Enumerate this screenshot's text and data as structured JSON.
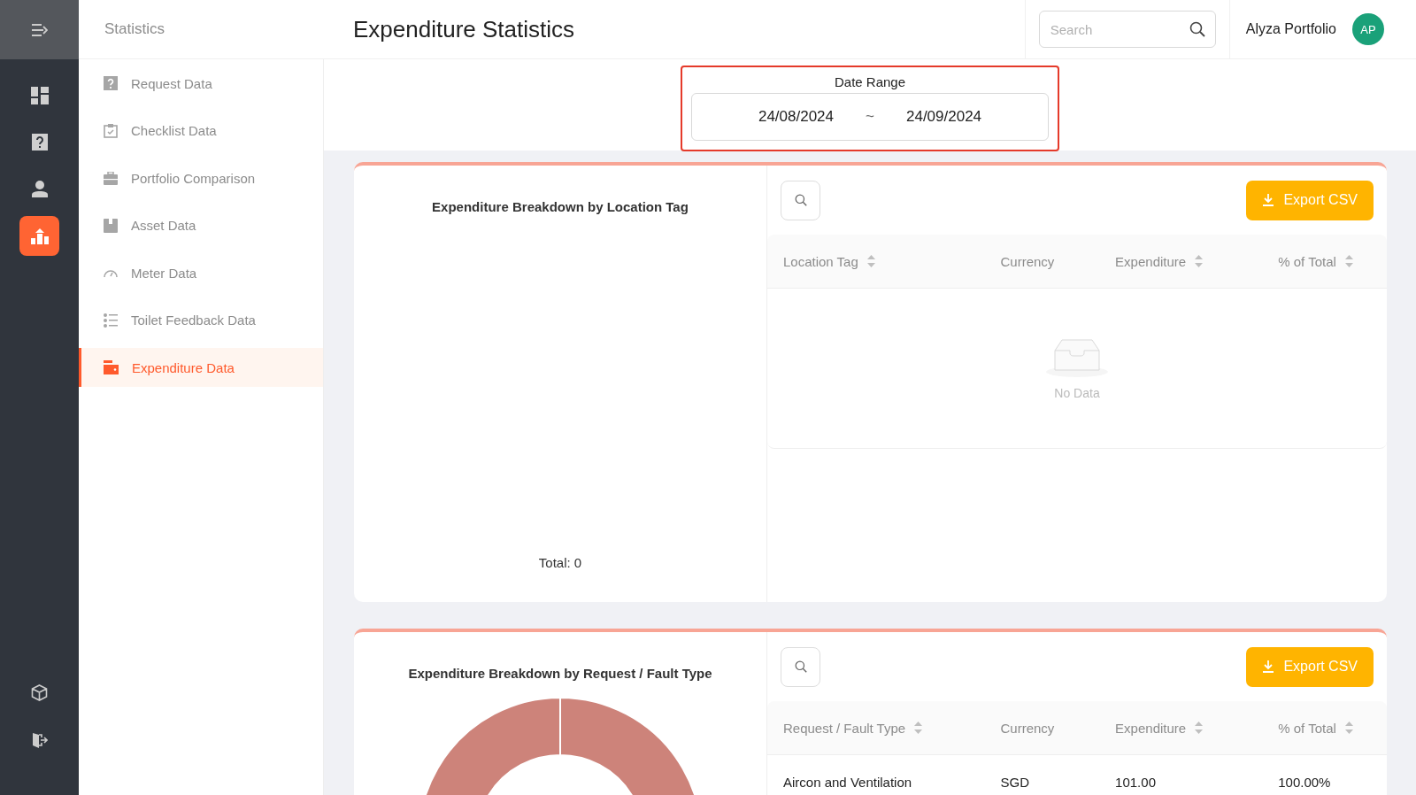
{
  "rail": {
    "items": [
      {
        "selected": false
      },
      {
        "selected": false
      },
      {
        "selected": false
      },
      {
        "selected": true
      }
    ]
  },
  "sidebar": {
    "title": "Statistics",
    "items": [
      {
        "label": "Request Data",
        "selected": false
      },
      {
        "label": "Checklist Data",
        "selected": false
      },
      {
        "label": "Portfolio Comparison",
        "selected": false
      },
      {
        "label": "Asset Data",
        "selected": false
      },
      {
        "label": "Meter Data",
        "selected": false
      },
      {
        "label": "Toilet Feedback Data",
        "selected": false
      },
      {
        "label": "Expenditure Data",
        "selected": true
      }
    ]
  },
  "header": {
    "title": "Expenditure Statistics",
    "search": {
      "placeholder": "Search"
    },
    "user": {
      "name": "Alyza Portfolio",
      "initials": "AP"
    }
  },
  "date_range": {
    "label": "Date Range",
    "start": "24/08/2024",
    "separator": "~",
    "end": "24/09/2024"
  },
  "panels": [
    {
      "chart_title": "Expenditure Breakdown by Location Tag",
      "kind": "empty",
      "total": "Total: 0",
      "export_label": "Export CSV",
      "table": {
        "columns": [
          {
            "label": "Location Tag",
            "sortable": true
          },
          {
            "label": "Currency",
            "sortable": false
          },
          {
            "label": "Expenditure",
            "sortable": true
          },
          {
            "label": "% of Total",
            "sortable": true
          }
        ],
        "empty_text": "No Data"
      }
    },
    {
      "chart_title": "Expenditure Breakdown by Request / Fault Type",
      "kind": "donut",
      "export_label": "Export CSV",
      "table": {
        "columns": [
          {
            "label": "Request / Fault Type",
            "sortable": true
          },
          {
            "label": "Currency",
            "sortable": false
          },
          {
            "label": "Expenditure",
            "sortable": true
          },
          {
            "label": "% of Total",
            "sortable": true
          }
        ],
        "rows": [
          [
            "Aircon and Ventilation",
            "SGD",
            "101.00",
            "100.00%"
          ]
        ]
      }
    }
  ]
}
